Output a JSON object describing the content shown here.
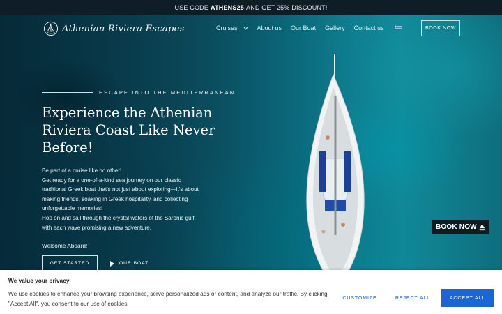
{
  "promo": {
    "prefix": "USE CODE",
    "code": "ATHENS25",
    "suffix": "AND GET 25% DISCOUNT!"
  },
  "nav": {
    "logo_text": "Athenian Riviera Escapes",
    "items": [
      {
        "label": "Cruises",
        "has_dropdown": true
      },
      {
        "label": "About us"
      },
      {
        "label": "Our Boat"
      },
      {
        "label": "Gallery"
      },
      {
        "label": "Contact us"
      }
    ],
    "language_flag": "greek-flag-icon",
    "book_button": "BOOK NOW"
  },
  "hero": {
    "eyebrow": "ESCAPE INTO THE MEDITERRANEAN",
    "headline": "Experience the Athenian Riviera Coast Like Never Before!",
    "paragraphs": [
      "Be part of a cruise like no other!",
      "Get ready for a one-of-a-kind sea journey on our classic traditional Greek boat that's not just about exploring—it's about making friends, soaking in Greek hospitality, and collecting unforgettable memories!",
      "Hop on and sail through the crystal waters of the Saronic gulf, with each wave promising a new adventure."
    ],
    "welcome": "Welcome Aboard!",
    "cta_primary": "GET STARTED",
    "cta_secondary": "OUR BOAT"
  },
  "floating_cta": {
    "label": "BOOK NOW",
    "icon": "sailboat-icon"
  },
  "cookie": {
    "title": "We value your privacy",
    "text": "We use cookies to enhance your browsing experience, serve personalized ads or content, and analyze our traffic. By clicking \"Accept All\", you consent to our use of cookies.",
    "customize": "CUSTOMIZE",
    "reject": "REJECT ALL",
    "accept": "ACCEPT ALL"
  },
  "colors": {
    "promo_bg": "#0e1d26",
    "accept_bg": "#1a66d6",
    "link_blue": "#1a5fd1",
    "float_bg": "#0f1b22"
  }
}
